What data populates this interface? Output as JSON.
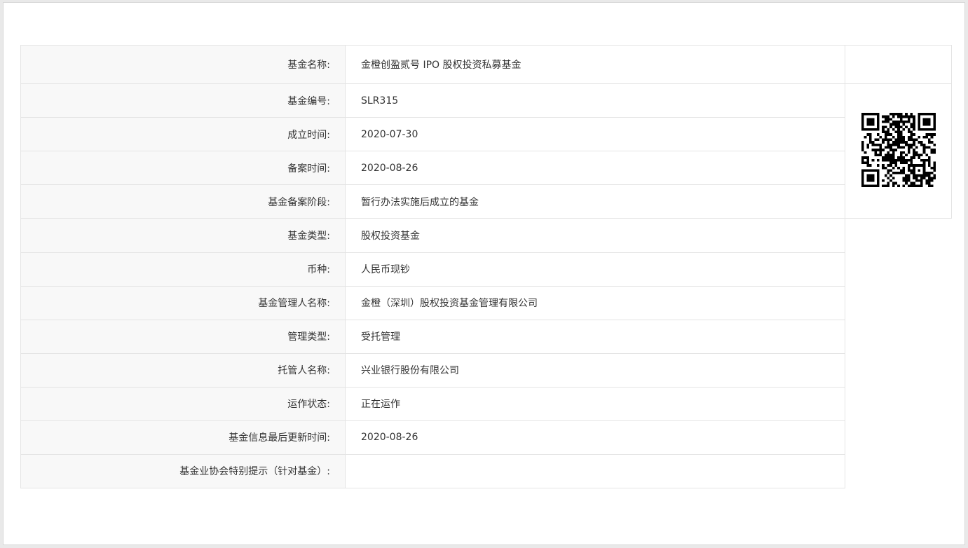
{
  "fund": {
    "rows": [
      {
        "label": "基金名称:",
        "value": "金橙创盈贰号 IPO 股权投资私募基金"
      },
      {
        "label": "基金编号:",
        "value": "SLR315"
      },
      {
        "label": "成立时间:",
        "value": "2020-07-30"
      },
      {
        "label": "备案时间:",
        "value": "2020-08-26"
      },
      {
        "label": "基金备案阶段:",
        "value": "暂行办法实施后成立的基金"
      },
      {
        "label": "基金类型:",
        "value": "股权投资基金"
      },
      {
        "label": "币种:",
        "value": "人民币现钞"
      },
      {
        "label": "基金管理人名称:",
        "value": "金橙（深圳）股权投资基金管理有限公司"
      },
      {
        "label": "管理类型:",
        "value": "受托管理"
      },
      {
        "label": "托管人名称:",
        "value": "兴业银行股份有限公司"
      },
      {
        "label": "运作状态:",
        "value": "正在运作"
      },
      {
        "label": "基金信息最后更新时间:",
        "value": "2020-08-26"
      },
      {
        "label": "基金业协会特别提示（针对基金）:",
        "value": ""
      }
    ]
  },
  "qr": {
    "icon": "qr-code-icon",
    "color": "#000000"
  }
}
